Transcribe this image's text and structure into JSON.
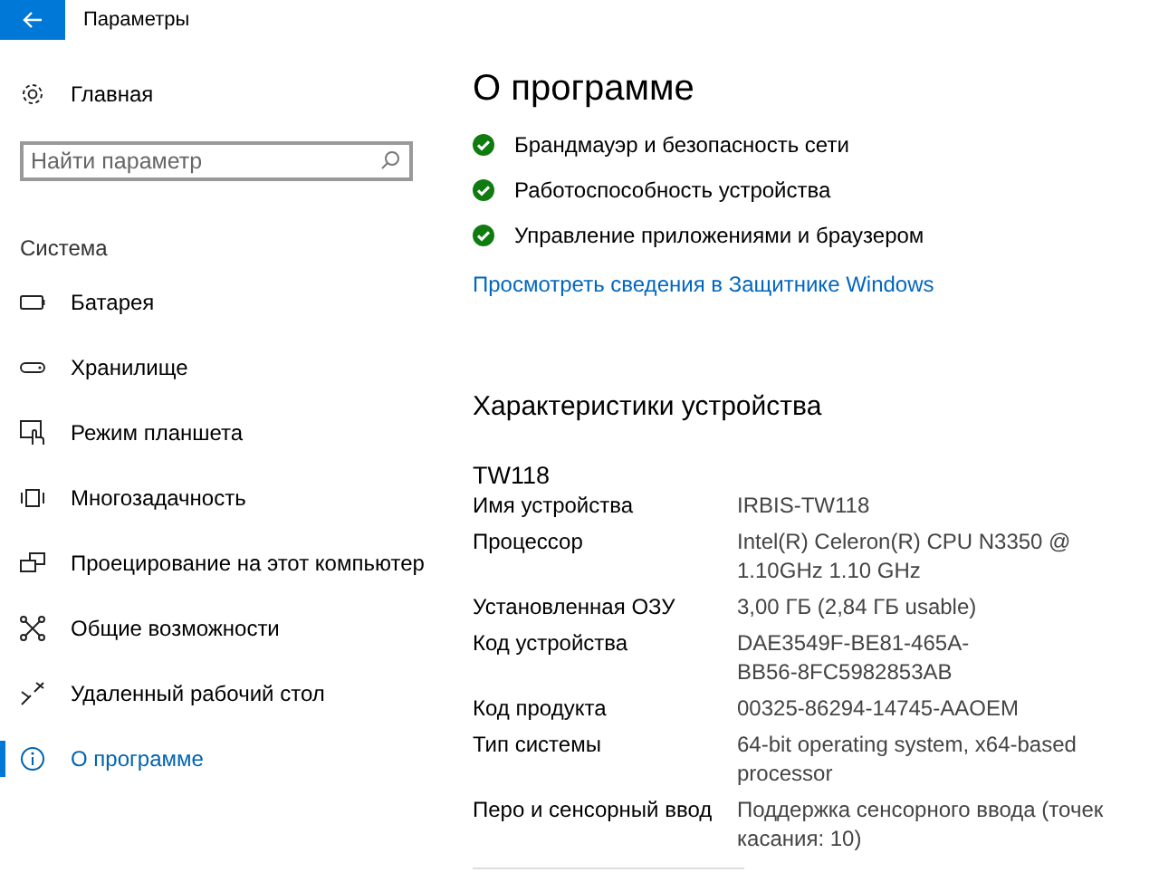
{
  "window": {
    "title": "Параметры"
  },
  "sidebar": {
    "home": "Главная",
    "search": {
      "placeholder": "Найти параметр"
    },
    "section": "Система",
    "items": [
      {
        "label": "Батарея",
        "kind": "battery",
        "selected": false
      },
      {
        "label": "Хранилище",
        "kind": "storage",
        "selected": false
      },
      {
        "label": "Режим планшета",
        "kind": "tablet",
        "selected": false
      },
      {
        "label": "Многозадачность",
        "kind": "multitask",
        "selected": false
      },
      {
        "label": "Проецирование на этот компьютер",
        "kind": "project",
        "selected": false
      },
      {
        "label": "Общие возможности",
        "kind": "shared",
        "selected": false
      },
      {
        "label": "Удаленный рабочий стол",
        "kind": "remote",
        "selected": false
      },
      {
        "label": "О программе",
        "kind": "info",
        "selected": true
      }
    ]
  },
  "content": {
    "title": "О программе",
    "security": [
      {
        "label": "Брандмауэр и безопасность сети",
        "ok": true
      },
      {
        "label": "Работоспособность устройства",
        "ok": true
      },
      {
        "label": "Управление приложениями и браузером",
        "ok": true
      }
    ],
    "link": "Просмотреть сведения в Защитнике Windows",
    "specs_title": "Характеристики устройства",
    "device": "TW118",
    "specs": [
      {
        "label": "Имя устройства",
        "value": "IRBIS-TW118"
      },
      {
        "label": "Процессор",
        "value": "Intel(R) Celeron(R) CPU N3350 @\n1.10GHz   1.10 GHz"
      },
      {
        "label": "Установленная ОЗУ",
        "value": "3,00 ГБ (2,84 ГБ usable)"
      },
      {
        "label": "Код устройства",
        "value": "DAE3549F-BE81-465A-\nBB56-8FC5982853AB"
      },
      {
        "label": "Код продукта",
        "value": "00325-86294-14745-AAOEM"
      },
      {
        "label": "Тип системы",
        "value": "64-bit operating system, x64-based\nprocessor"
      },
      {
        "label": "Перо и сенсорный ввод",
        "value": "Поддержка сенсорного ввода (точек\nкасания: 10)"
      }
    ]
  }
}
